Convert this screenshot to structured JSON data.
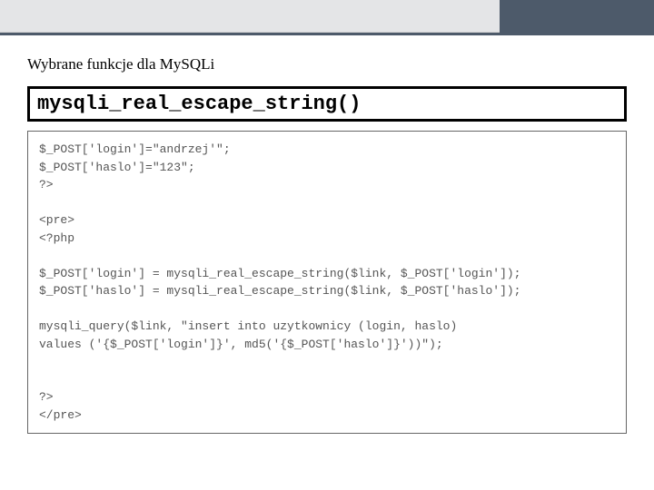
{
  "section_title": "Wybrane funkcje dla MySQLi",
  "header_box": "mysqli_real_escape_string()",
  "code_lines": "$_POST['login']=\"andrzej'\";\n$_POST['haslo']=\"123\";\n?>\n\n<pre>\n<?php\n\n$_POST['login'] = mysqli_real_escape_string($link, $_POST['login']);\n$_POST['haslo'] = mysqli_real_escape_string($link, $_POST['haslo']);\n\nmysqli_query($link, \"insert into uzytkownicy (login, haslo)\nvalues ('{$_POST['login']}', md5('{$_POST['haslo']}'))\");\n\n\n?>\n</pre>"
}
